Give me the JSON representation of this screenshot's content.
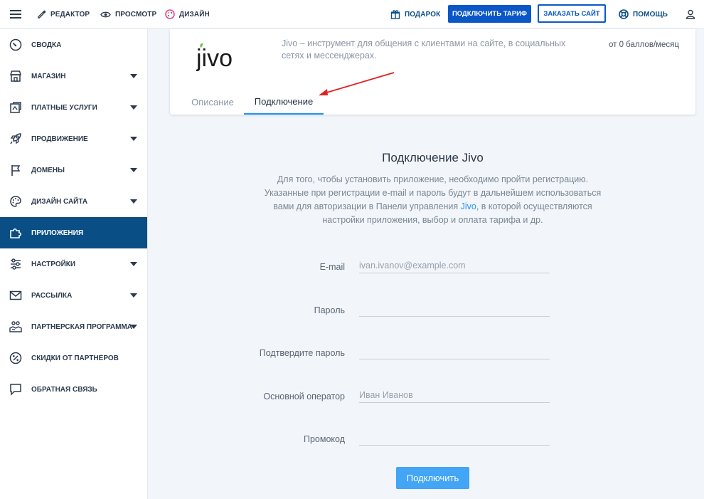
{
  "topbar": {
    "editor": "Редактор",
    "preview": "Просмотр",
    "design": "Дизайн",
    "gift": "Подарок",
    "tariff_button": "Подключить тариф",
    "order_button": "Заказать сайт",
    "help": "Помощь"
  },
  "sidebar": {
    "items": [
      {
        "label": "Сводка",
        "icon": "gauge-icon"
      },
      {
        "label": "Магазин",
        "icon": "store-icon"
      },
      {
        "label": "Платные услуги",
        "icon": "paid-services-icon"
      },
      {
        "label": "Продвижение",
        "icon": "rocket-icon"
      },
      {
        "label": "Домены",
        "icon": "flag-icon"
      },
      {
        "label": "Дизайн сайта",
        "icon": "palette-icon"
      },
      {
        "label": "Приложения",
        "icon": "puzzle-icon"
      },
      {
        "label": "Настройки",
        "icon": "sliders-icon"
      },
      {
        "label": "Рассылка",
        "icon": "mail-icon"
      },
      {
        "label": "Партнерская программа",
        "icon": "partner-icon"
      },
      {
        "label": "Скидки от партнеров",
        "icon": "percent-icon"
      },
      {
        "label": "Обратная связь",
        "icon": "chat-icon"
      }
    ],
    "active": "Приложения"
  },
  "app": {
    "logo_text": "jivo",
    "description": "Jivo – инструмент для общения с клиентами на сайте, в социальных сетях и мессенджерах.",
    "price": "от 0 баллов/месяц",
    "tabs": [
      "Описание",
      "Подключение"
    ],
    "active_tab": "Подключение"
  },
  "connect": {
    "title": "Подключение Jivo",
    "intro_before": "Для того, чтобы установить приложение, необходимо пройти регистрацию. Указанные при регистрации e-mail и пароль будут в дальнейшем использоваться вами для авторизации в Панели управления ",
    "intro_link": "Jivo",
    "intro_after": ", в которой осуществляются настройки приложения, выбор и оплата тарифа и др.",
    "fields": {
      "email_label": "E-mail",
      "email_placeholder": "ivan.ivanov@example.com",
      "password_label": "Пароль",
      "confirm_label": "Подтвердите пароль",
      "operator_label": "Основной оператор",
      "operator_placeholder": "Иван Иванов",
      "promo_label": "Промокод"
    },
    "submit": "Подключить"
  },
  "colors": {
    "accent": "#0b57c8",
    "sidebar_active": "#0a4e86",
    "tab_underline": "#2196f3",
    "submit": "#42a5f5",
    "logo_leaf": "#6cc04a"
  }
}
